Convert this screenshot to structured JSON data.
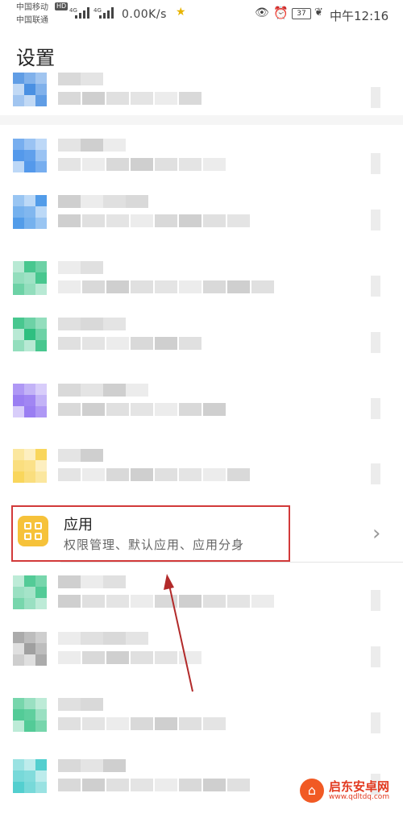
{
  "status_bar": {
    "carrier_1": "中国移动",
    "carrier_1_badge": "HD",
    "carrier_2": "中国联通",
    "signal_1": "4G",
    "signal_2": "4G",
    "net_speed": "0.00K/s",
    "battery": "37",
    "time": "中午12:16",
    "icons": [
      "star-icon",
      "eye-icon",
      "alarm-icon",
      "leaf-icon"
    ]
  },
  "header": {
    "title": "设置"
  },
  "highlighted_item": {
    "title": "应用",
    "subtitle": "权限管理、默认应用、应用分身",
    "icon": "apps-grid-icon",
    "icon_color": "#f6c23a"
  },
  "blurred_icon_colors": [
    "#4a90e2",
    "#3d8be8",
    "#3a8fe6",
    "#2fbf80",
    "#2fbf80",
    "#8c6cf0",
    "#f8d046",
    "#3cc489",
    "#a0a0a0",
    "#3cc489",
    "#3cc8c8"
  ],
  "annotation": {
    "highlight_color": "#d23a3a",
    "arrow_color": "#b22a2a"
  },
  "watermark": {
    "name": "启东安卓网",
    "url": "www.qdltdq.com"
  }
}
